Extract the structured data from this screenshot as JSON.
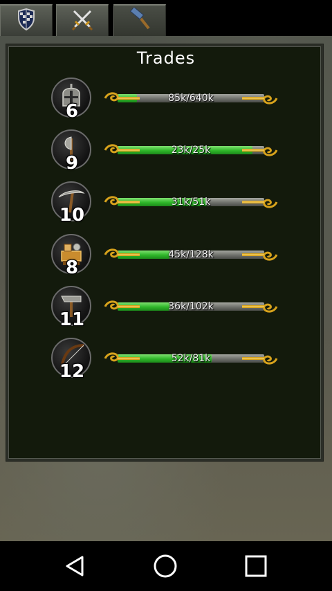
{
  "header": {
    "tabs": [
      {
        "icon": "shield-icon"
      },
      {
        "icon": "crossed-swords-icon"
      },
      {
        "icon": "hammer-icon",
        "active": true
      }
    ]
  },
  "panel": {
    "title": "Trades"
  },
  "trades": [
    {
      "icon": "helmet-icon",
      "level": "6",
      "progress_label": "85k/640k",
      "progress": 0.133
    },
    {
      "icon": "axe-icon",
      "level": "9",
      "progress_label": "23k/25k",
      "progress": 0.92
    },
    {
      "icon": "pickaxe-icon",
      "level": "10",
      "progress_label": "31k/51k",
      "progress": 0.608
    },
    {
      "icon": "crafting-icon",
      "level": "8",
      "progress_label": "45k/128k",
      "progress": 0.352
    },
    {
      "icon": "hammer-icon",
      "level": "11",
      "progress_label": "36k/102k",
      "progress": 0.353
    },
    {
      "icon": "bow-icon",
      "level": "12",
      "progress_label": "52k/81k",
      "progress": 0.642
    }
  ],
  "colors": {
    "bar_fill": "#2fb62a",
    "bar_track": "#6f716c",
    "cap_gold": "#d7a21c",
    "panel_bg": "#131a0c"
  },
  "navbar": {
    "back": "back-icon",
    "home": "home-icon",
    "recents": "recents-icon"
  }
}
